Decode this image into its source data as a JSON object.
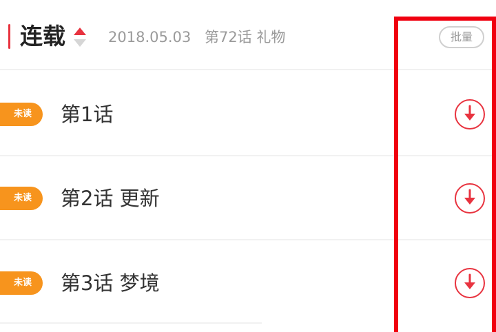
{
  "header": {
    "title": "连载",
    "sort_icon": "sort-updown-icon",
    "update_date": "2018.05.03",
    "latest_chapter": "第72话 礼物",
    "batch_label": "批量"
  },
  "chapters": [
    {
      "badge": "未读",
      "title": "第1话",
      "download_icon": "download-icon"
    },
    {
      "badge": "未读",
      "title": "第2话 更新",
      "download_icon": "download-icon"
    },
    {
      "badge": "未读",
      "title": "第3话 梦境",
      "download_icon": "download-icon"
    }
  ],
  "colors": {
    "accent": "#e8333f",
    "badge": "#f7941d",
    "highlight": "#f0000f",
    "muted_text": "#9a9a9a"
  }
}
